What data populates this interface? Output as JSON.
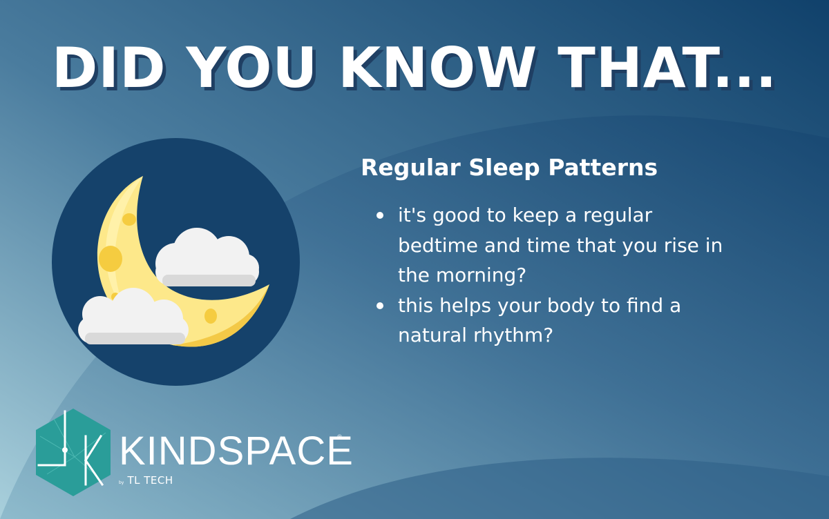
{
  "headline": "DID YOU KNOW THAT...",
  "card": {
    "title": "Regular Sleep Patterns",
    "bullets": [
      "it's good to keep a regular bedtime and time that you rise in the morning?",
      "this helps your body to find a natural rhythm?"
    ]
  },
  "illustration": {
    "icon": "moon-with-clouds-icon"
  },
  "brand": {
    "name": "KINDSPACE",
    "registered": "®",
    "by": "by",
    "company": "TL TECH",
    "logo_icon": "kindspace-hexagon-logo"
  },
  "colors": {
    "bg_dark": "#15426b",
    "bg_light": "#9ccad6",
    "circle": "#15426b",
    "moon": "#fde88a",
    "teal": "#2a9d99"
  }
}
